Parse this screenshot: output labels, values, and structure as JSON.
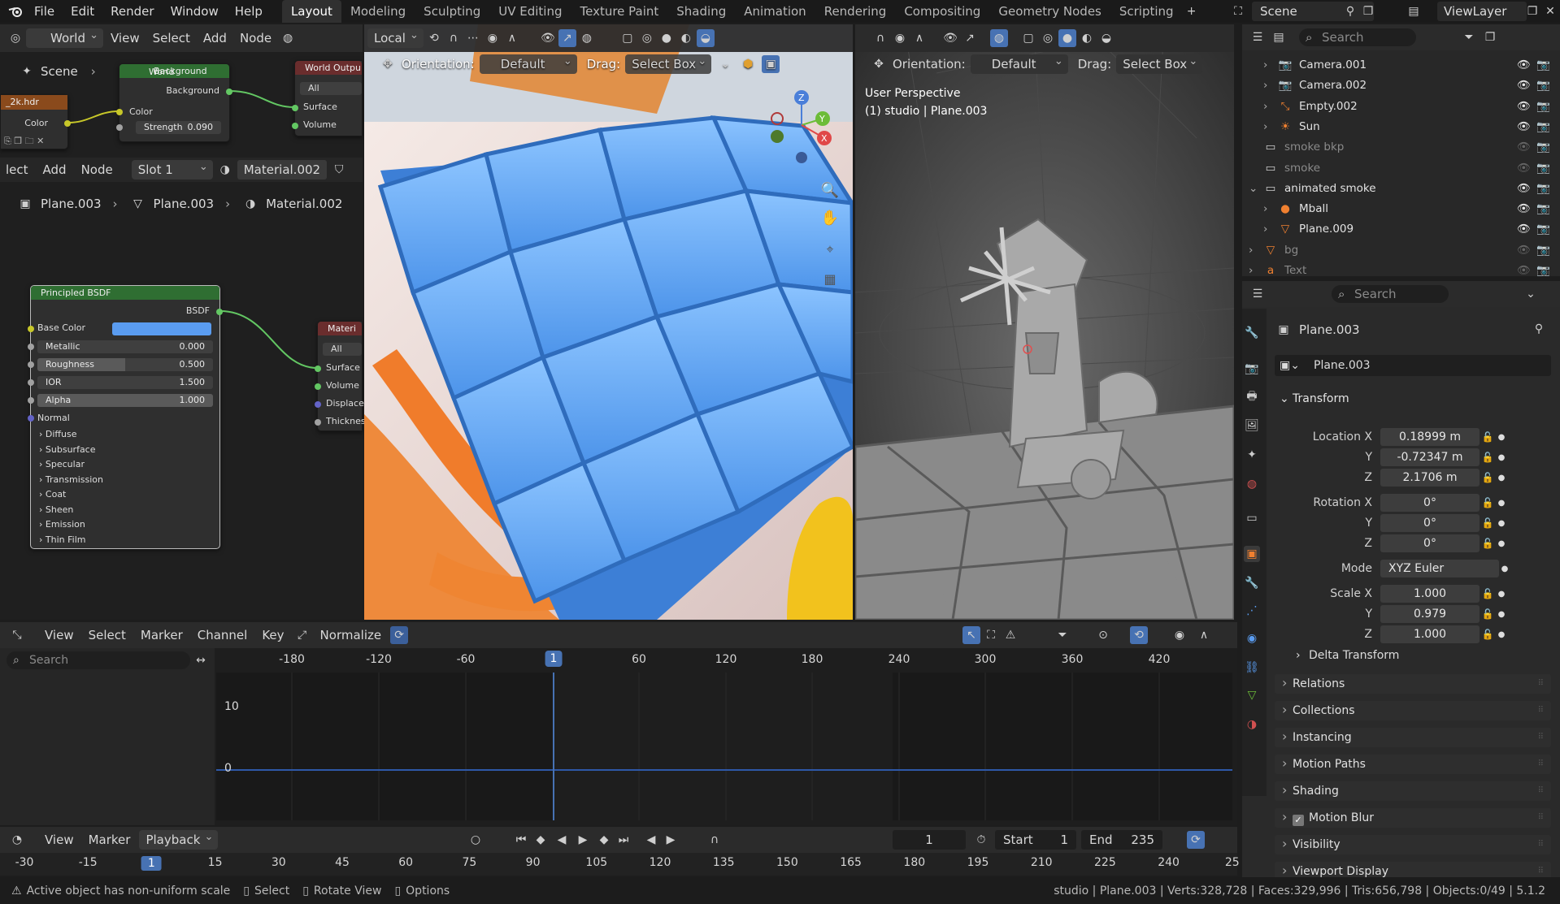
{
  "topbar": {
    "menus": [
      "File",
      "Edit",
      "Render",
      "Window",
      "Help"
    ],
    "workspaces": [
      "Layout",
      "Modeling",
      "Sculpting",
      "UV Editing",
      "Texture Paint",
      "Shading",
      "Animation",
      "Rendering",
      "Compositing",
      "Geometry Nodes",
      "Scripting"
    ],
    "active_workspace": "Layout",
    "scene_label": "Scene",
    "viewlayer_label": "ViewLayer"
  },
  "node_editor": {
    "world_dropdown": "World",
    "menus": [
      "View",
      "Select",
      "Add",
      "Node"
    ],
    "menus2": [
      "lect",
      "Add",
      "Node"
    ],
    "slot": "Slot 1",
    "material": "Material.002",
    "breadcrumb": [
      "Plane.003",
      "Plane.003",
      "Material.002"
    ],
    "hdr_label": "_2k.hdr",
    "hdr_color": "Color",
    "world_node_title": "World",
    "bg_node_title": "Background",
    "bg_output": "Background",
    "bg_color": "Color",
    "bg_strength_label": "Strength",
    "bg_strength_value": "0.090",
    "world_output_title": "World Outpu",
    "world_output_target": "All",
    "world_output_surface": "Surface",
    "world_output_volume": "Volume",
    "bsdf": {
      "title": "Principled BSDF",
      "output": "BSDF",
      "base_color_label": "Base Color",
      "base_color": "#5a9cf0",
      "metallic_label": "Metallic",
      "metallic": "0.000",
      "roughness_label": "Roughness",
      "roughness": "0.500",
      "ior_label": "IOR",
      "ior": "1.500",
      "alpha_label": "Alpha",
      "alpha": "1.000",
      "normal": "Normal",
      "panels": [
        "Diffuse",
        "Subsurface",
        "Specular",
        "Transmission",
        "Coat",
        "Sheen",
        "Emission",
        "Thin Film"
      ]
    },
    "mat_output": {
      "title": "Materi",
      "target": "All",
      "sockets": [
        "Surface",
        "Volume",
        "Displace",
        "Thicknes"
      ]
    }
  },
  "viewport_left": {
    "transform_space": "Local",
    "orientation_label": "Orientation:",
    "orientation": "Default",
    "drag_label": "Drag:",
    "drag": "Select Box"
  },
  "viewport_right": {
    "orientation_label": "Orientation:",
    "orientation": "Default",
    "drag_label": "Drag:",
    "drag": "Select Box",
    "view_name": "User Perspective",
    "view_context": "(1) studio | Plane.003"
  },
  "outliner": {
    "search_placeholder": "Search",
    "rows": [
      {
        "name": "Camera.001",
        "icon": "camera-icon",
        "expanded": false
      },
      {
        "name": "Camera.002",
        "icon": "camera-icon",
        "expanded": false
      },
      {
        "name": "Empty.002",
        "icon": "empty-icon",
        "expanded": false
      },
      {
        "name": "Sun",
        "icon": "light-icon",
        "expanded": false
      },
      {
        "name": "smoke bkp",
        "icon": "collection-icon",
        "expanded": false
      },
      {
        "name": "smoke",
        "icon": "collection-icon",
        "expanded": false
      },
      {
        "name": "animated smoke",
        "icon": "collection-icon",
        "expanded": true
      },
      {
        "name": "Mball",
        "icon": "metaball-icon",
        "expanded": false
      },
      {
        "name": "Plane.009",
        "icon": "mesh-icon",
        "expanded": false
      },
      {
        "name": "bg",
        "icon": "mesh-icon",
        "expanded": false
      },
      {
        "name": "Text",
        "icon": "text-icon",
        "expanded": false
      }
    ]
  },
  "properties": {
    "search_placeholder": "Search",
    "object_name": "Plane.003",
    "object_field": "Plane.003",
    "transform_title": "Transform",
    "location_label": "Location X",
    "location": [
      "0.18999 m",
      "-0.72347 m",
      "2.1706 m"
    ],
    "rotation_label": "Rotation X",
    "rotation": [
      "0°",
      "0°",
      "0°"
    ],
    "mode_label": "Mode",
    "mode": "XYZ Euler",
    "scale_label": "Scale X",
    "scale": [
      "1.000",
      "0.979",
      "1.000"
    ],
    "axis_y": "Y",
    "axis_z": "Z",
    "delta_transform": "Delta Transform",
    "sections": [
      "Relations",
      "Collections",
      "Instancing",
      "Motion Paths",
      "Shading",
      "Motion Blur",
      "Visibility",
      "Viewport Display"
    ]
  },
  "graph_editor": {
    "menus": [
      "View",
      "Select",
      "Marker",
      "Channel",
      "Key"
    ],
    "normalize": "Normalize",
    "search_placeholder": "Search",
    "frame_ticks": [
      "-180",
      "-120",
      "-60",
      "1",
      "60",
      "120",
      "180",
      "240",
      "300",
      "360",
      "420"
    ],
    "current_frame": "1",
    "value_ticks": [
      "10",
      "0"
    ]
  },
  "timeline": {
    "menus": [
      "View",
      "Marker"
    ],
    "playback": "Playback",
    "current_frame": "1",
    "start_label": "Start",
    "start": "1",
    "end_label": "End",
    "end": "235",
    "ticks": [
      "-30",
      "-15",
      "1",
      "15",
      "30",
      "45",
      "60",
      "75",
      "90",
      "105",
      "120",
      "135",
      "150",
      "165",
      "180",
      "195",
      "210",
      "225",
      "240",
      "25"
    ]
  },
  "statusbar": {
    "warning": "Active object has non-uniform scale",
    "hints": [
      "Select",
      "Rotate View",
      "Options"
    ],
    "stats": "studio | Plane.003 | Verts:328,728 | Faces:329,996 | Tris:656,798 | Objects:0/49 | 5.1.2"
  }
}
